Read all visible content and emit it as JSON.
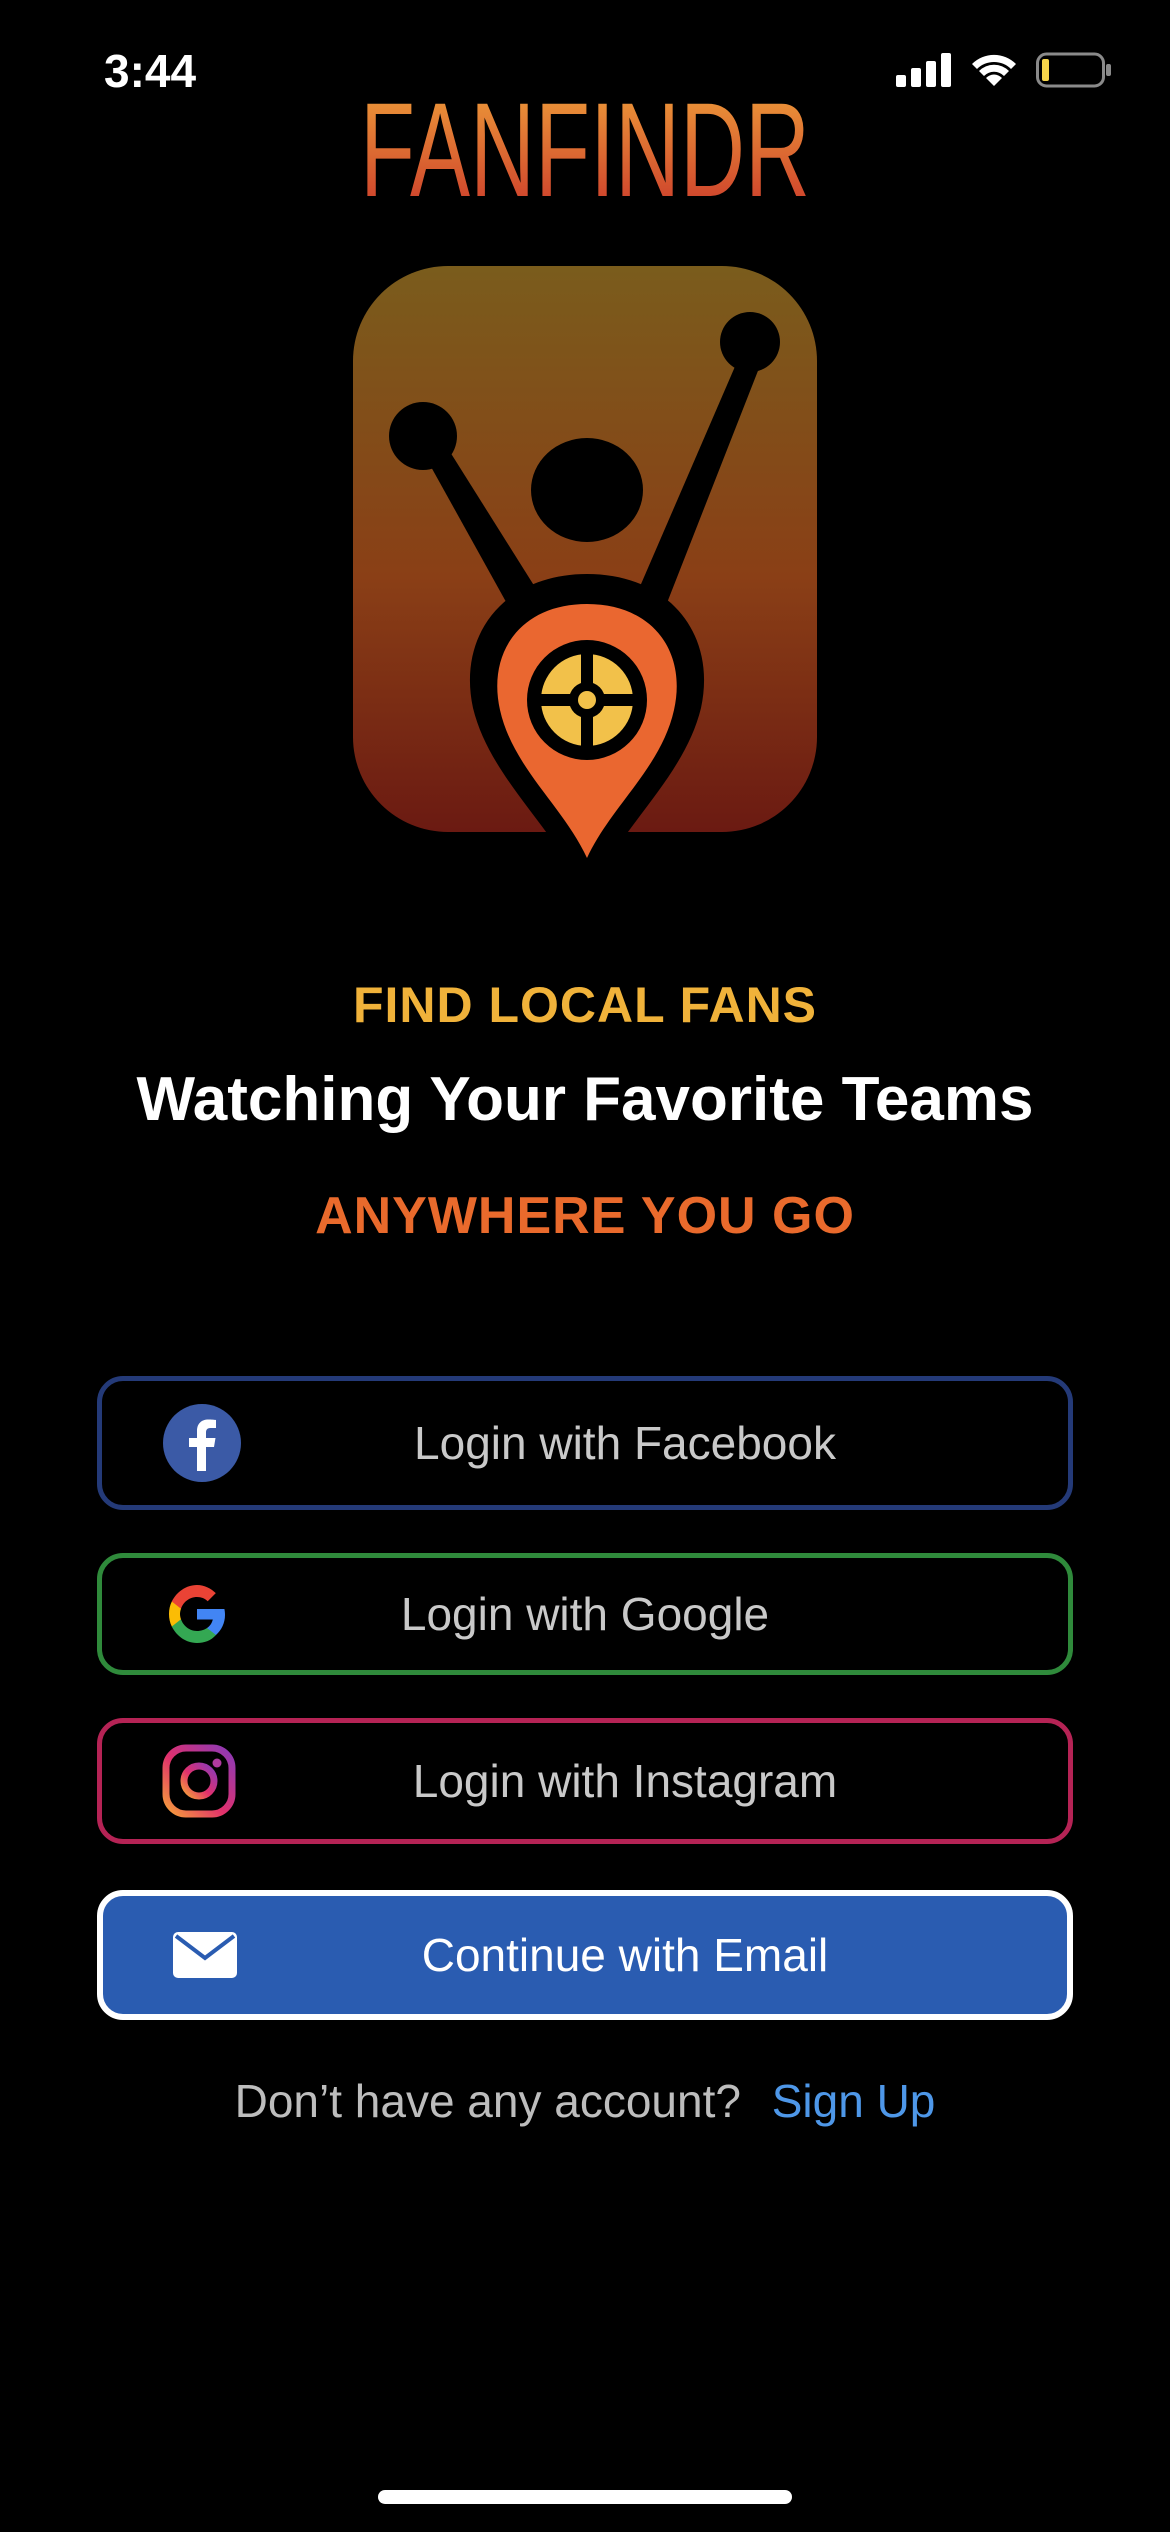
{
  "status_bar": {
    "time": "3:44"
  },
  "brand": {
    "name": "FANFINDR"
  },
  "tagline": {
    "line1": "FIND LOCAL FANS",
    "line2": "Watching Your Favorite Teams",
    "line3": "ANYWHERE YOU GO"
  },
  "login_buttons": [
    {
      "label": "Login with Facebook",
      "icon": "facebook-icon",
      "border_color": "#243a78"
    },
    {
      "label": "Login with Google",
      "icon": "google-icon",
      "border_color": "#2f8a3b"
    },
    {
      "label": "Login with Instagram",
      "icon": "instagram-icon",
      "border_color": "#b52355"
    },
    {
      "label": "Continue with Email",
      "icon": "mail-icon",
      "border_color": "#ffffff",
      "fill_color": "#2a5cb1"
    }
  ],
  "signup": {
    "question": "Don’t have any account?",
    "link": "Sign Up"
  },
  "colors": {
    "accent_yellow": "#f0b23a",
    "accent_orange": "#e96a2c",
    "link_blue": "#4e97e8"
  }
}
